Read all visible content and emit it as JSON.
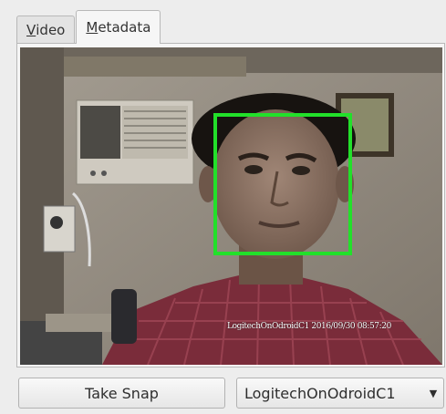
{
  "tabs": [
    {
      "mnemonic": "V",
      "rest": "ideo",
      "active": false
    },
    {
      "mnemonic": "M",
      "rest": "etadata",
      "active": true
    }
  ],
  "video": {
    "timestamp_overlay": "LogitechOnOdroidC1 2016/09/30 08:57:20",
    "face_box_color": "#22e02a"
  },
  "buttons": {
    "take_snap": "Take Snap"
  },
  "camera_select": {
    "selected": "LogitechOnOdroidC1"
  },
  "icons": {
    "combo_arrow": "chevron-down-icon"
  }
}
